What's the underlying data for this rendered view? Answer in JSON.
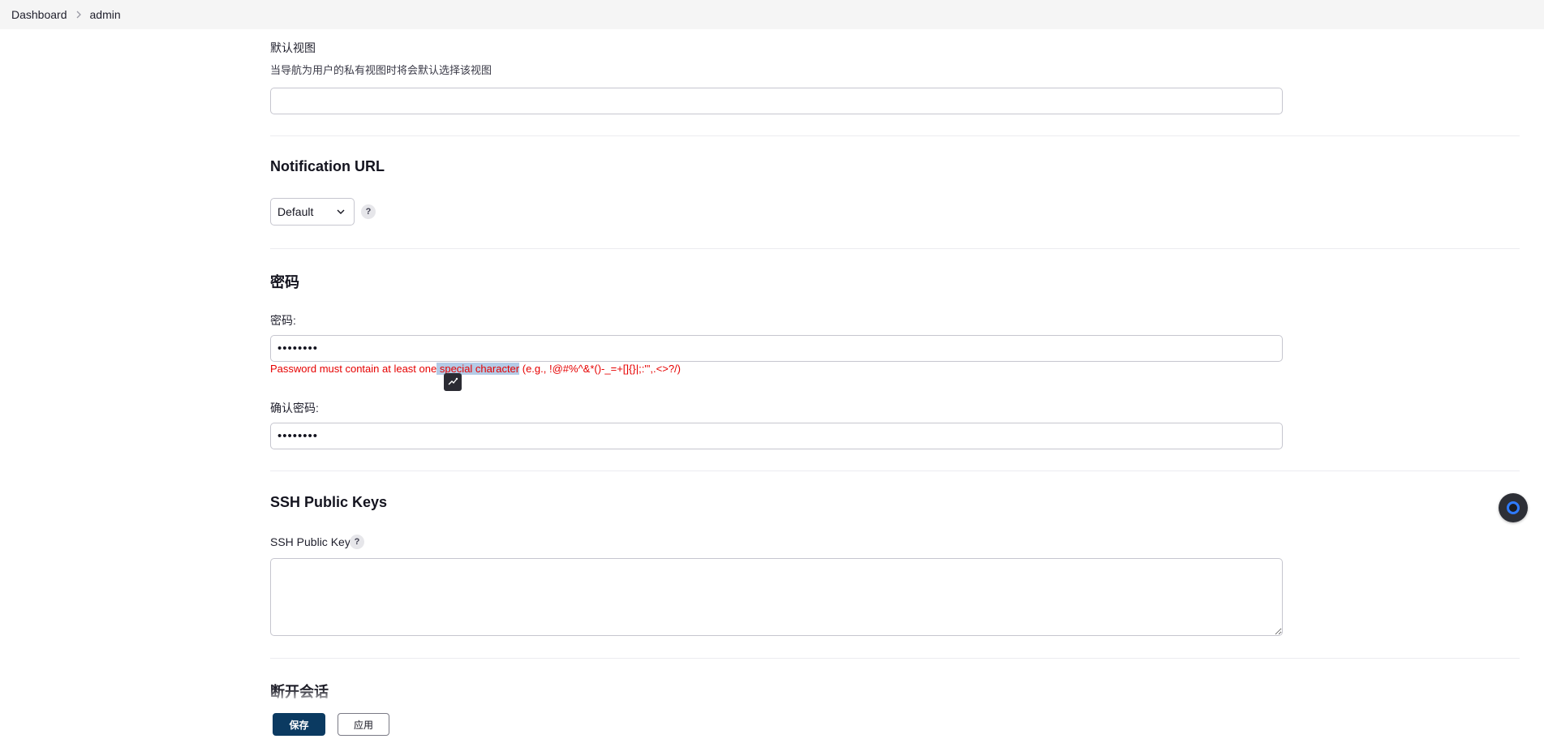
{
  "breadcrumb": {
    "items": [
      "Dashboard",
      "admin"
    ]
  },
  "default_view": {
    "label": "默认视图",
    "description": "当导航为用户的私有视图时将会默认选择该视图",
    "value": ""
  },
  "notification": {
    "title": "Notification URL",
    "selected": "Default",
    "help": "?"
  },
  "password": {
    "section_title": "密码",
    "label": "密码:",
    "value": "••••••••",
    "error_before": "Password must contain at least one",
    "error_highlight": " special character",
    "error_after": " (e.g., !@#%^&*()-_=+[]{}|;:'\",.<>?/)",
    "confirm_label": "确认密码:",
    "confirm_value": "••••••••"
  },
  "ssh": {
    "section_title": "SSH Public Keys",
    "label": "SSH Public Keys",
    "help": "?",
    "value": ""
  },
  "session": {
    "section_title": "断开会话"
  },
  "actions": {
    "save_label": "保存",
    "apply_label": "应用"
  },
  "colors": {
    "primary_button": "#0b3a61",
    "error_text": "#e60000",
    "selection_highlight": "#b4cbe6",
    "fab_ring": "#2f7bff"
  }
}
